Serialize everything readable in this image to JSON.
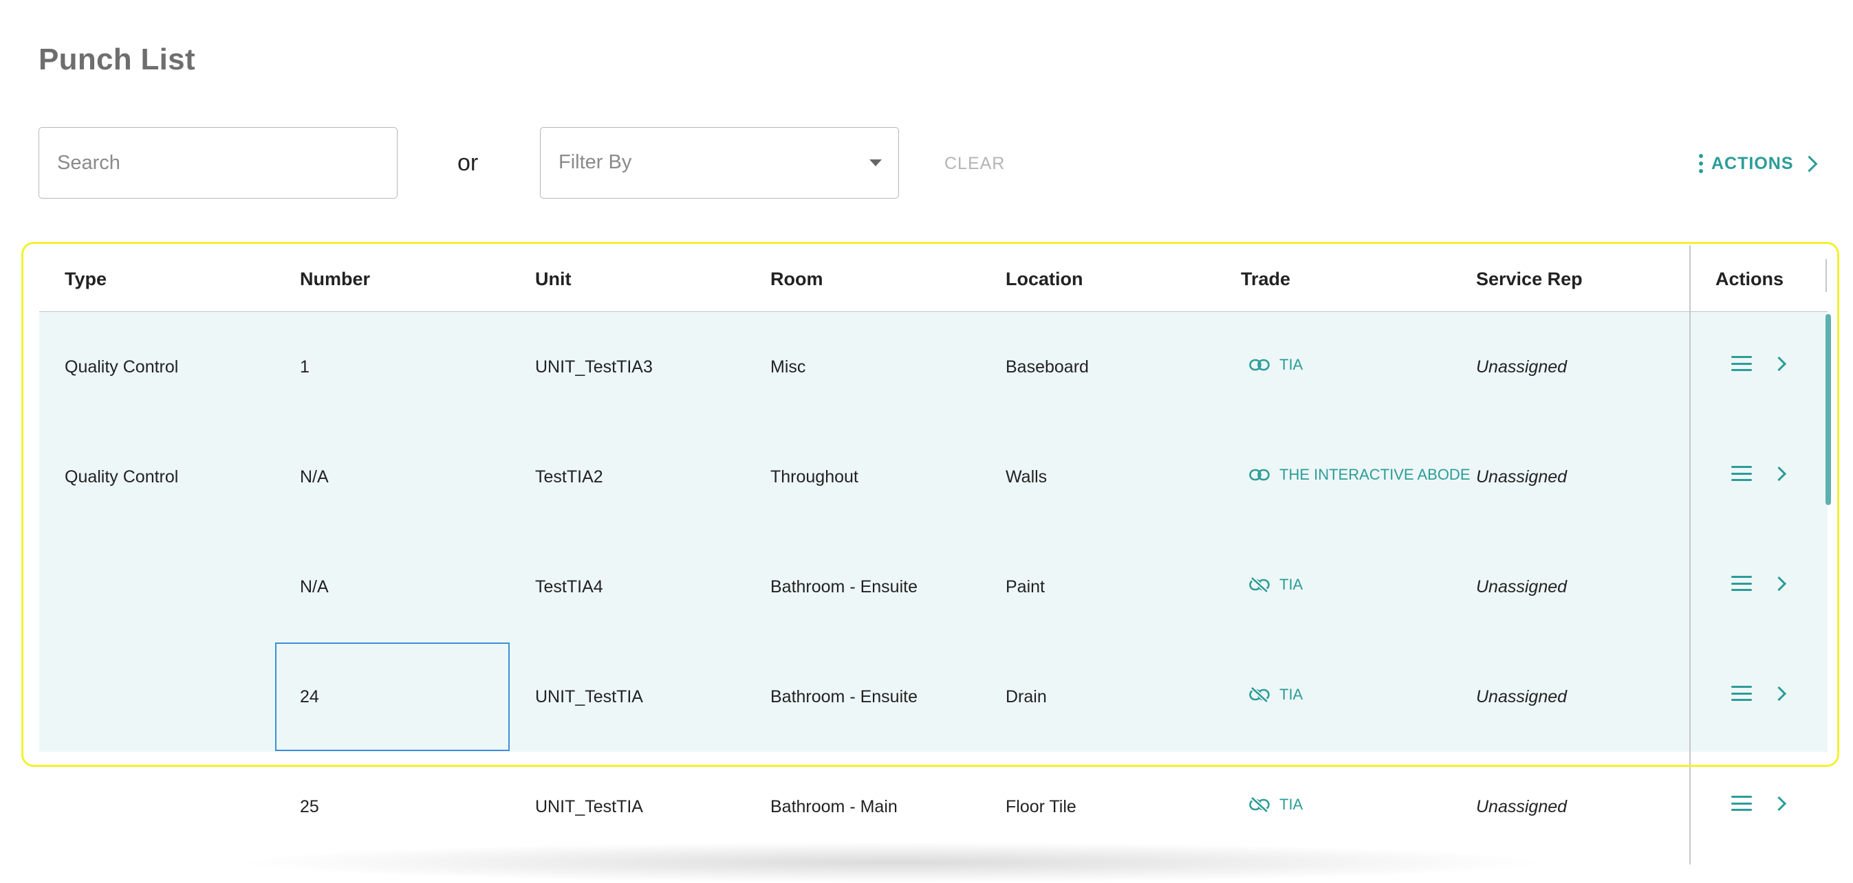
{
  "page": {
    "title": "Punch List"
  },
  "toolbar": {
    "search_placeholder": "Search",
    "or_label": "or",
    "filter_label": "Filter By",
    "clear_label": "CLEAR",
    "actions_label": "ACTIONS"
  },
  "table": {
    "columns": [
      "Type",
      "Number",
      "Unit",
      "Room",
      "Location",
      "Trade",
      "Service Rep",
      "Actions"
    ],
    "rows": [
      {
        "type": "Quality Control",
        "number": "1",
        "unit": "UNIT_TestTIA3",
        "room": "Misc",
        "location": "Baseboard",
        "trade": "TIA",
        "trade_icon": "link-icon",
        "service_rep": "Unassigned",
        "highlighted": true
      },
      {
        "type": "Quality Control",
        "number": "N/A",
        "unit": "TestTIA2",
        "room": "Throughout",
        "location": "Walls",
        "trade": "THE INTERACTIVE ABODE",
        "trade_icon": "link-icon",
        "service_rep": "Unassigned",
        "highlighted": true
      },
      {
        "type": "",
        "number": "N/A",
        "unit": "TestTIA4",
        "room": "Bathroom - Ensuite",
        "location": "Paint",
        "trade": "TIA",
        "trade_icon": "unlink-icon",
        "service_rep": "Unassigned",
        "highlighted": true
      },
      {
        "type": "",
        "number": "24",
        "unit": "UNIT_TestTIA",
        "room": "Bathroom - Ensuite",
        "location": "Drain",
        "trade": "TIA",
        "trade_icon": "unlink-icon",
        "service_rep": "Unassigned",
        "highlighted": true
      },
      {
        "type": "",
        "number": "25",
        "unit": "UNIT_TestTIA",
        "room": "Bathroom - Main",
        "location": "Floor Tile",
        "trade": "TIA",
        "trade_icon": "unlink-icon",
        "service_rep": "Unassigned",
        "highlighted": false
      }
    ]
  },
  "colors": {
    "accent": "#2b9c98",
    "row_highlight": "#eef7f7",
    "selection_outline": "#f2f22e",
    "focus_border": "#3a8fd8"
  }
}
